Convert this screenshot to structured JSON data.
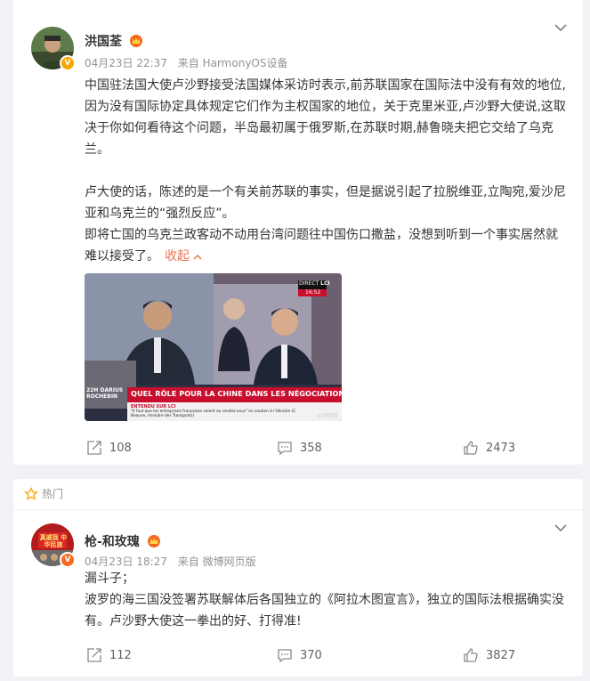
{
  "post": {
    "author": "洪国荃",
    "date": "04月23日 22:37",
    "source": "来自 HarmonyOS设备",
    "paragraphs": [
      "中国驻法国大使卢沙野接受法国媒体采访时表示,前苏联国家在国际法中没有有效的地位,因为没有国际协定具体规定它们作为主权国家的地位，关于克里米亚,卢沙野大使说,这取决于你如何看待这个问题，半岛最初属于俄罗斯,在苏联时期,赫鲁晓夫把它交给了乌克兰。",
      "卢大使的话，陈述的是一个有关前苏联的事实，但是据说引起了拉脱维亚,立陶宛,爱沙尼亚和乌克兰的“强烈反应”。",
      "即将亡国的乌克兰政客动不动用台湾问题往中国伤口撒盐，没想到听到一个事实居然就难以接受了。"
    ],
    "collapse_label": "收起",
    "video": {
      "banner": "QUEL RÔLE POUR LA CHINE DANS LES NÉGOCIATIONS ?",
      "ticker_label": "ENTENDU SUR LCI",
      "ticker_text": "\"Il faut que les entreprises françaises soient au rendez-vous\" en soutien à l'Ukraine (C. Beaune, ministre des Transports)",
      "channel": "LCI",
      "live": "DIRECT",
      "clock": "16:52",
      "promo_time": "22H",
      "promo_name": "DARIUS ROCHEBIN",
      "watermark": "@洪国荃"
    },
    "reposts": "108",
    "comments": "358",
    "likes": "2473"
  },
  "hot_label": "热门",
  "comment": {
    "author": "枪-和玫瑰",
    "date": "04月23日 18:27",
    "source": "来自 微博网页版",
    "avatar_text": "真戚我 中华民族",
    "lines": [
      "漏斗子；",
      "波罗的海三国没签署苏联解体后各国独立的《阿拉木图宣言》，独立的国际法根据确实没有。卢沙野大使这一拳出的好、打得准!"
    ],
    "reposts": "112",
    "comments": "370",
    "likes": "3827"
  },
  "colors": {
    "background": "#f1f2f5",
    "accent": "#eb7350",
    "meta": "#939393",
    "banner_red": "#c8102e"
  }
}
